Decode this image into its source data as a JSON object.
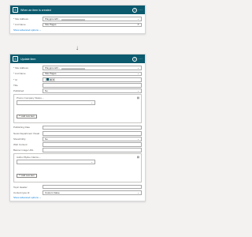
{
  "trigger": {
    "title": "When an item is created",
    "help_icon": "question-icon",
    "more_icon": "ellipsis-icon",
    "fields": [
      {
        "label": "* Site Address",
        "value": "Playground3 –",
        "redacted": true
      },
      {
        "label": "* List Name",
        "value": "Site Pages"
      }
    ],
    "advanced_link": "Show advanced options"
  },
  "action": {
    "title": "Update item",
    "help_icon": "question-icon",
    "more_icon": "ellipsis-icon",
    "site_address": {
      "label": "* Site Address",
      "value": "Playground3 –"
    },
    "list_name": {
      "label": "* List Name",
      "value": "Site Pages"
    },
    "id": {
      "label": "* Id",
      "chip": "ID"
    },
    "title_row": {
      "label": "Title",
      "value": ""
    },
    "published": {
      "label": "Published",
      "value": "No"
    },
    "promo_group": {
      "label": "Promo Company Status –",
      "add_label": "Add new item"
    },
    "publishing_date": {
      "label": "Publishing Date",
      "value": ""
    },
    "news_dept_visual": {
      "label": "News Department Visual",
      "value": ""
    },
    "show_on_fly": {
      "label": "ShowOnFly",
      "value": "No"
    },
    "web_content": {
      "label": "Web Content",
      "value": ""
    },
    "banner_image": {
      "label": "Banner image URL",
      "value": ""
    },
    "author_group": {
      "label": "Author Byline Claims –",
      "add_label": "Add new item"
    },
    "topic_header": {
      "label": "Topic Header",
      "value": ""
    },
    "content_type": {
      "label": "Content type Id",
      "value": "Custom Value"
    },
    "advanced_link": "Show advanced options"
  },
  "colors": {
    "trigger_header": "#0b5a6d",
    "action_header": "#0b5a6d",
    "link": "#0078d4"
  }
}
